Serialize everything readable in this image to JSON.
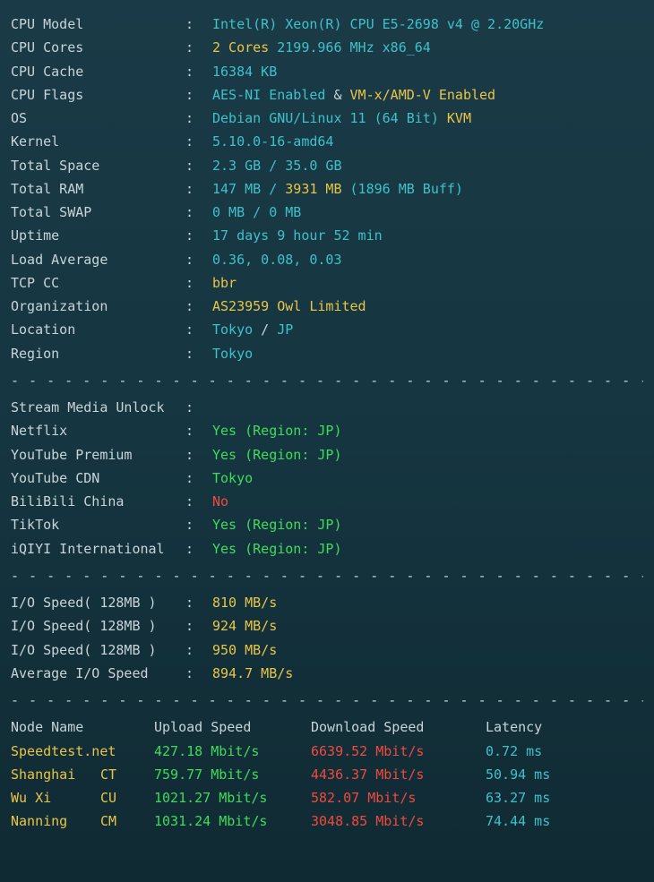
{
  "sysinfo": {
    "cpu_model_label": "CPU Model",
    "cpu_model_value": "Intel(R) Xeon(R) CPU E5-2698 v4 @ 2.20GHz",
    "cpu_cores_label": "CPU Cores",
    "cpu_cores_value": "2 Cores",
    "cpu_cores_extra": "2199.966 MHz x86_64",
    "cpu_cache_label": "CPU Cache",
    "cpu_cache_value": "16384 KB",
    "cpu_flags_label": "CPU Flags",
    "cpu_flags_aes": "AES-NI Enabled",
    "cpu_flags_amp": " & ",
    "cpu_flags_vm": "VM-x/AMD-V Enabled",
    "os_label": "OS",
    "os_value": "Debian GNU/Linux 11 (64 Bit)",
    "os_virt": "KVM",
    "kernel_label": "Kernel",
    "kernel_value": "5.10.0-16-amd64",
    "total_space_label": "Total Space",
    "total_space_used": "2.3 GB",
    "total_space_total": "35.0 GB",
    "total_ram_label": "Total RAM",
    "total_ram_used": "147 MB",
    "total_ram_total": "3931 MB",
    "total_ram_buff": "(1896 MB Buff)",
    "total_swap_label": "Total SWAP",
    "total_swap_value": "0 MB / 0 MB",
    "uptime_label": "Uptime",
    "uptime_value": "17 days 9 hour 52 min",
    "load_label": "Load Average",
    "load_value": "0.36, 0.08, 0.03",
    "tcp_label": "TCP CC",
    "tcp_value": "bbr",
    "org_label": "Organization",
    "org_value": "AS23959 Owl Limited",
    "location_label": "Location",
    "location_city": "Tokyo",
    "location_country": "JP",
    "region_label": "Region",
    "region_value": "Tokyo"
  },
  "stream": {
    "header": "Stream Media Unlock",
    "netflix_label": "Netflix",
    "netflix_value": "Yes (Region: JP)",
    "ytpremium_label": "YouTube Premium",
    "ytpremium_value": "Yes (Region: JP)",
    "ytcdn_label": "YouTube CDN",
    "ytcdn_value": "Tokyo",
    "bilibili_label": "BiliBili China",
    "bilibili_value": "No",
    "tiktok_label": "TikTok",
    "tiktok_value": "Yes (Region: JP)",
    "iqiyi_label": "iQIYI International",
    "iqiyi_value": "Yes (Region: JP)"
  },
  "io": {
    "test1_label": "I/O Speed( 128MB )",
    "test1_value": "810 MB/s",
    "test2_label": "I/O Speed( 128MB )",
    "test2_value": "924 MB/s",
    "test3_label": "I/O Speed( 128MB )",
    "test3_value": "950 MB/s",
    "avg_label": "Average I/O Speed",
    "avg_value": "894.7 MB/s"
  },
  "speed": {
    "header_node": "Node Name",
    "header_upload": "Upload Speed",
    "header_download": "Download Speed",
    "header_latency": "Latency",
    "rows": [
      {
        "name": "Speedtest.net",
        "provider": "",
        "upload": "427.18 Mbit/s",
        "download": "6639.52 Mbit/s",
        "latency": "0.72 ms"
      },
      {
        "name": "Shanghai",
        "provider": "CT",
        "upload": "759.77 Mbit/s",
        "download": "4436.37 Mbit/s",
        "latency": "50.94 ms"
      },
      {
        "name": "Wu Xi",
        "provider": "CU",
        "upload": "1021.27 Mbit/s",
        "download": "582.07 Mbit/s",
        "latency": "63.27 ms"
      },
      {
        "name": "Nanning",
        "provider": "CM",
        "upload": "1031.24 Mbit/s",
        "download": "3048.85 Mbit/s",
        "latency": "74.44 ms"
      }
    ]
  },
  "separator": "- - - - - - - - - - - - - - - - - - - - - - - - - - - - - - - - - - - - - - - - - - - - - - - -"
}
